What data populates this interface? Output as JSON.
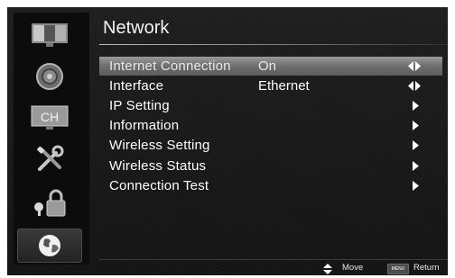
{
  "title": "Network",
  "sidebar": {
    "items": [
      {
        "icon": "picture-icon"
      },
      {
        "icon": "sound-icon"
      },
      {
        "icon": "channel-icon",
        "text": "CH"
      },
      {
        "icon": "tools-icon"
      },
      {
        "icon": "lock-icon"
      },
      {
        "icon": "network-globe-icon",
        "active": true
      }
    ]
  },
  "menu": {
    "items": [
      {
        "label": "Internet Connection",
        "value": "On",
        "control": "left-right",
        "selected": true
      },
      {
        "label": "Interface",
        "value": "Ethernet",
        "control": "left-right"
      },
      {
        "label": "IP Setting",
        "value": "",
        "control": "right"
      },
      {
        "label": "Information",
        "value": "",
        "control": "right"
      },
      {
        "label": "Wireless Setting",
        "value": "",
        "control": "right"
      },
      {
        "label": "Wireless Status",
        "value": "",
        "control": "right"
      },
      {
        "label": "Connection Test",
        "value": "",
        "control": "right"
      }
    ]
  },
  "footer": {
    "move_label": "Move",
    "menu_key": "MENU",
    "return_label": "Return"
  },
  "colors": {
    "background": "#181818",
    "selected_row": "#7a7a7a",
    "text": "#ffffff"
  }
}
